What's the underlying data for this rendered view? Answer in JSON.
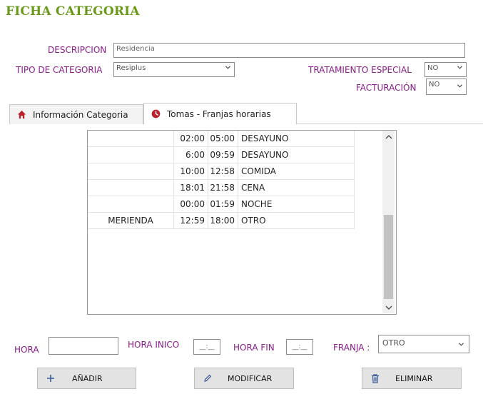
{
  "title": "FICHA CATEGORIA",
  "form": {
    "descripcion_label": "DESCRIPCION",
    "descripcion_value": "Residencia",
    "tipo_label": "TIPO DE CATEGORIA",
    "tipo_value": "Resiplus",
    "tratamiento_label": "TRATAMIENTO ESPECIAL",
    "tratamiento_value": "NO",
    "facturacion_label": "FACTURACIÓN",
    "facturacion_value": "NO"
  },
  "tabs": [
    {
      "label": "Información Categoria",
      "icon": "home-icon"
    },
    {
      "label": "Tomas - Franjas horarias",
      "icon": "clock-icon"
    }
  ],
  "grid": {
    "rows": [
      {
        "name": "",
        "start": "02:00",
        "end": "05:00",
        "franja": "DESAYUNO"
      },
      {
        "name": "",
        "start": "6:00",
        "end": "09:59",
        "franja": "DESAYUNO"
      },
      {
        "name": "",
        "start": "10:00",
        "end": "12:58",
        "franja": "COMIDA"
      },
      {
        "name": "",
        "start": "18:01",
        "end": "21:58",
        "franja": "CENA"
      },
      {
        "name": "",
        "start": "00:00",
        "end": "01:59",
        "franja": "NOCHE"
      },
      {
        "name": "MERIENDA",
        "start": "12:59",
        "end": "18:00",
        "franja": "OTRO"
      }
    ]
  },
  "bottom": {
    "hora_label": "HORA",
    "hora_inicio_label": "HORA INICO",
    "hora_inicio_value": "__:__",
    "hora_fin_label": "HORA FIN",
    "hora_fin_value": "__:__",
    "franja_label": "FRANJA :",
    "franja_value": "OTRO"
  },
  "buttons": {
    "add": "AÑADIR",
    "modify": "MODIFICAR",
    "delete": "ELIMINAR"
  },
  "colors": {
    "title": "#6a9a1a",
    "label": "#8a1c8a",
    "tab_icon": "#b8222c"
  }
}
